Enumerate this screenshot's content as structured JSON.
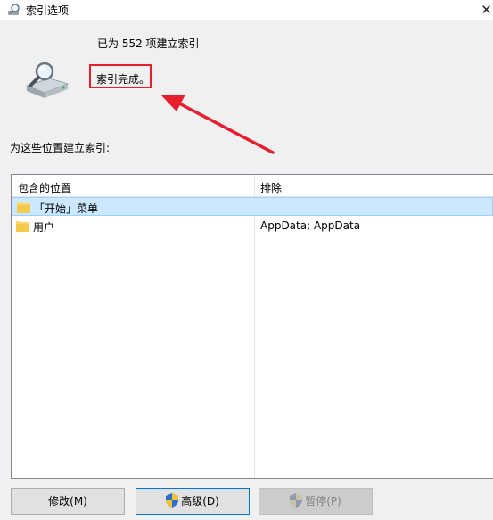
{
  "window": {
    "title": "索引选项",
    "close_glyph": "✕"
  },
  "status": {
    "indexed_count": "已为 552 项建立索引",
    "message": "索引完成。",
    "icon": "search-drive-icon"
  },
  "locations": {
    "label": "为这些位置建立索引:",
    "columns": [
      "包含的位置",
      "排除"
    ],
    "rows": [
      {
        "location": "「开始」菜单",
        "exclude": "",
        "selected": true,
        "icon": "folder-icon"
      },
      {
        "location": "用户",
        "exclude": "AppData; AppData",
        "selected": false,
        "icon": "folder-icon"
      }
    ]
  },
  "buttons": {
    "modify": "修改(M)",
    "advanced": "高级(D)",
    "pause": "暂停(P)"
  },
  "colors": {
    "highlight_red": "#e81e2d",
    "selection": "#cce8ff",
    "folder": "#fcd66b"
  }
}
